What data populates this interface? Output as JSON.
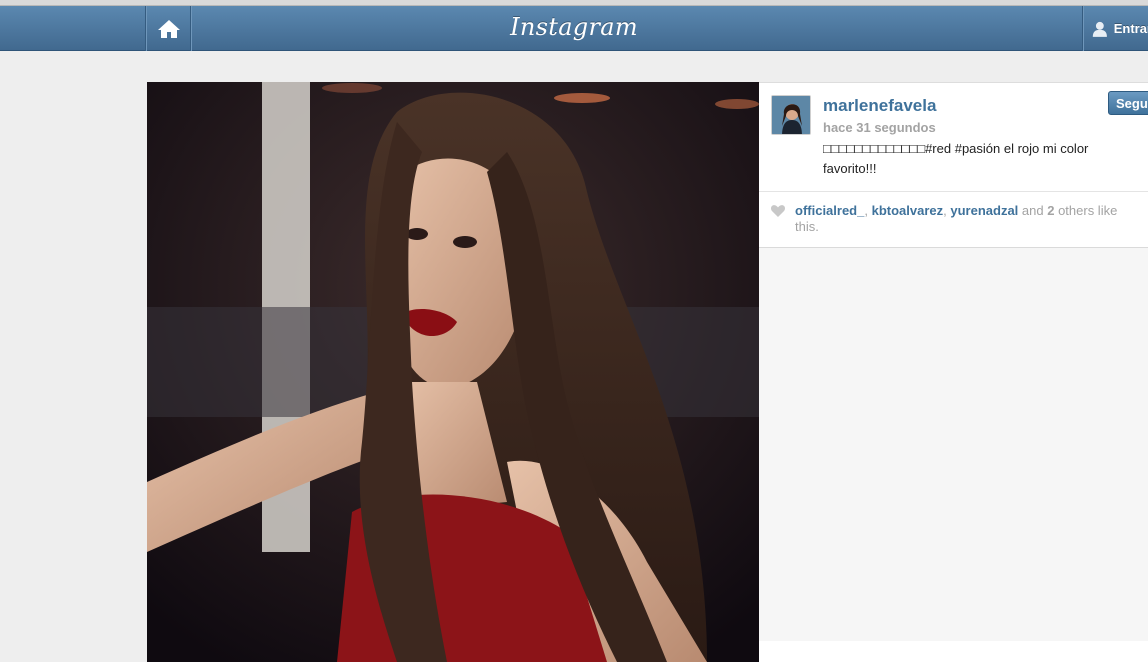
{
  "header": {
    "logo_text": "Instagram",
    "home_icon": "home-icon",
    "login_label": "Entrar",
    "user_icon": "user-icon"
  },
  "post": {
    "username": "marlenefavela",
    "timestamp": "hace 31 segundos",
    "caption": "□□□□□□□□□□□□□#red #pasión el rojo mi color favorito!!!",
    "follow_label": "Seguir",
    "likes": {
      "likers": [
        "officialred_",
        "kbtoalvarez",
        "yurenadzal"
      ],
      "sep1": ", ",
      "sep2": ", ",
      "and_text": " and ",
      "others_count": "2",
      "others_text": " others like this."
    }
  },
  "colors": {
    "header_top": "#5b88b0",
    "header_bottom": "#41698f",
    "link": "#3f729b",
    "muted": "#a3a3a3"
  }
}
